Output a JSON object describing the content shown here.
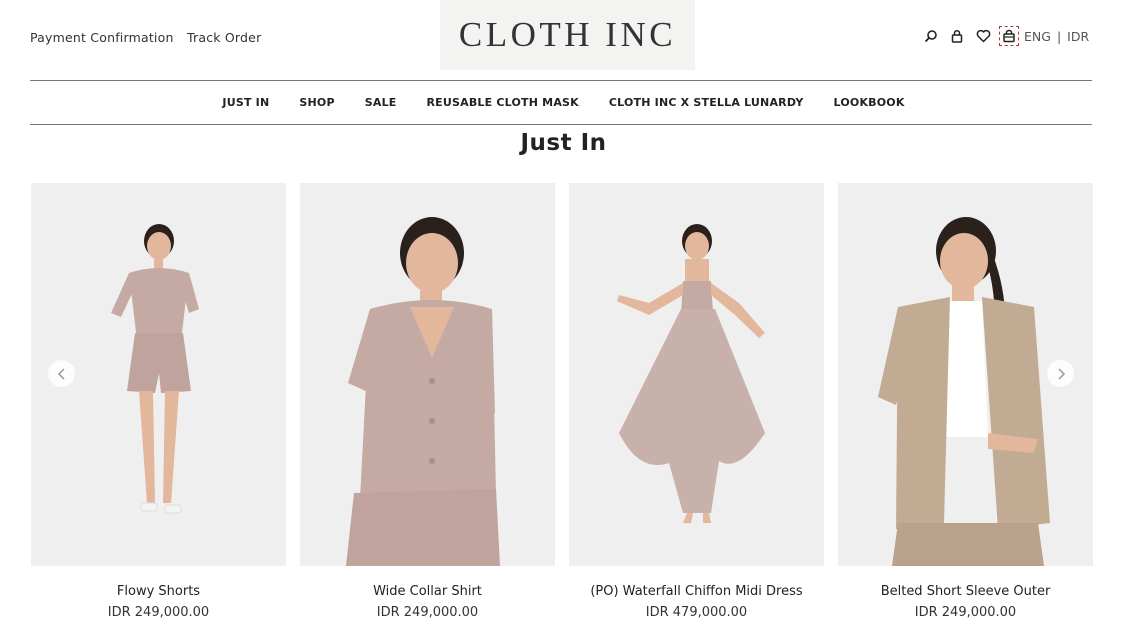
{
  "header": {
    "payment_confirmation": "Payment Confirmation",
    "track_order": "Track Order",
    "logo": "CLOTH INC",
    "icons": [
      "search-icon",
      "lock-icon",
      "heart-icon",
      "bag-icon"
    ],
    "lang": "ENG",
    "currency": "IDR"
  },
  "nav": {
    "items": [
      "JUST IN",
      "SHOP",
      "SALE",
      "REUSABLE CLOTH MASK",
      "CLOTH INC X STELLA LUNARDY",
      "LOOKBOOK"
    ]
  },
  "section": {
    "title": "Just In"
  },
  "products": [
    {
      "name": "Flowy Shorts",
      "price": "IDR 249,000.00"
    },
    {
      "name": "Wide Collar Shirt",
      "price": "IDR 249,000.00"
    },
    {
      "name": "(PO) Waterfall Chiffon Midi Dress",
      "price": "IDR 479,000.00"
    },
    {
      "name": "Belted Short Sleeve Outer",
      "price": "IDR 249,000.00"
    }
  ],
  "colors": {
    "garment_mauve": "#c4aaa3",
    "garment_beige": "#c2ab93",
    "photo_bg": "#efefef",
    "skin": "#e2b79b",
    "hair": "#2a211d"
  }
}
